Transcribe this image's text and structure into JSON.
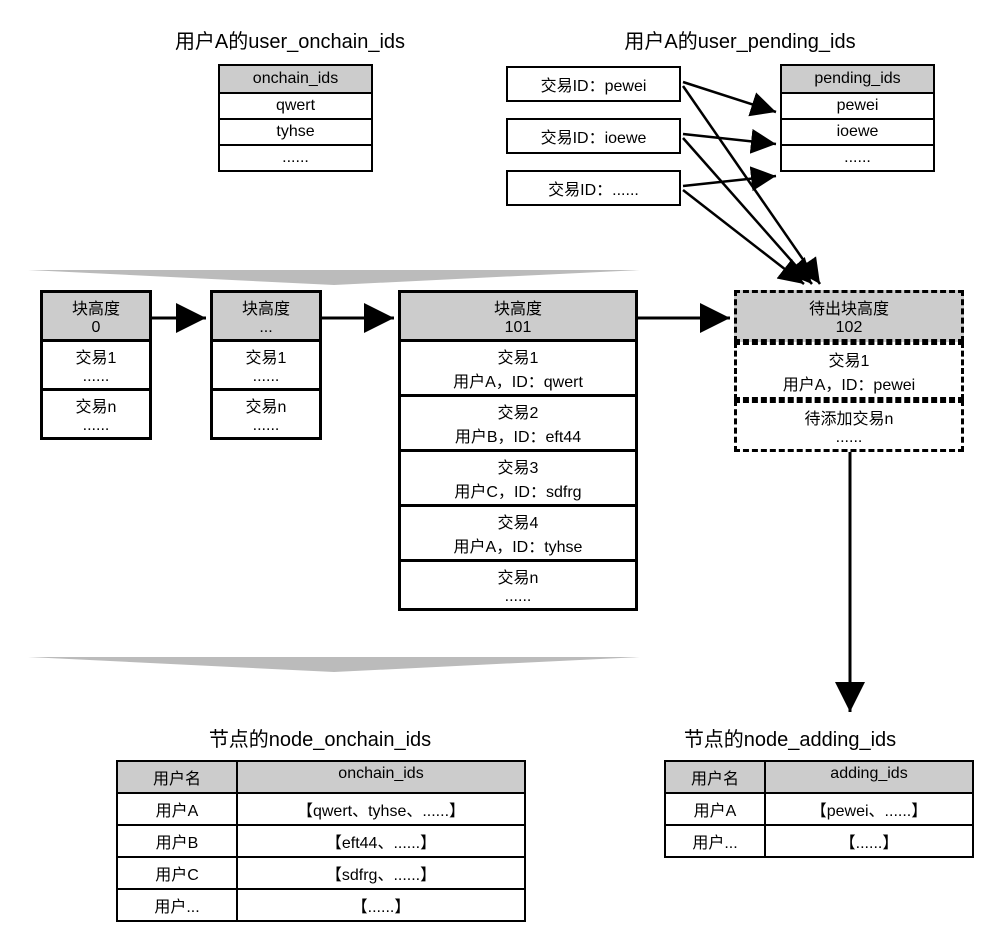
{
  "titles": {
    "user_onchain": "用户A的user_onchain_ids",
    "user_pending": "用户A的user_pending_ids",
    "node_onchain": "节点的node_onchain_ids",
    "node_adding": "节点的node_adding_ids"
  },
  "onchain_ids_box": {
    "header": "onchain_ids",
    "rows": [
      "qwert",
      "tyhse",
      "......"
    ]
  },
  "tx_id_boxes": [
    "交易ID：pewei",
    "交易ID：ioewe",
    "交易ID：......"
  ],
  "pending_ids_box": {
    "header": "pending_ids",
    "rows": [
      "pewei",
      "ioewe",
      "......"
    ]
  },
  "blocks": {
    "b0": {
      "head_l1": "块高度",
      "head_l2": "0",
      "cells": [
        "交易1",
        "......",
        "交易n",
        "......"
      ]
    },
    "bdots": {
      "head_l1": "块高度",
      "head_l2": "...",
      "cells": [
        "交易1",
        "......",
        "交易n",
        "......"
      ]
    },
    "b101": {
      "head_l1": "块高度",
      "head_l2": "101",
      "cells": [
        "交易1",
        "用户A，ID：qwert",
        "交易2",
        "用户B，ID：eft44",
        "交易3",
        "用户C，ID：sdfrg",
        "交易4",
        "用户A，ID：tyhse",
        "交易n",
        "......"
      ]
    },
    "b102": {
      "head_l1": "待出块高度",
      "head_l2": "102",
      "cells": [
        "交易1",
        "用户A，ID：pewei",
        "待添加交易n",
        "......"
      ]
    }
  },
  "node_onchain_table": {
    "head_user": "用户名",
    "head_ids": "onchain_ids",
    "rows": [
      {
        "u": "用户A",
        "v": "【qwert、tyhse、......】"
      },
      {
        "u": "用户B",
        "v": "【eft44、......】"
      },
      {
        "u": "用户C",
        "v": "【sdfrg、......】"
      },
      {
        "u": "用户...",
        "v": "【......】"
      }
    ]
  },
  "node_adding_table": {
    "head_user": "用户名",
    "head_ids": "adding_ids",
    "rows": [
      {
        "u": "用户A",
        "v": "【pewei、......】"
      },
      {
        "u": "用户...",
        "v": "【......】"
      }
    ]
  }
}
